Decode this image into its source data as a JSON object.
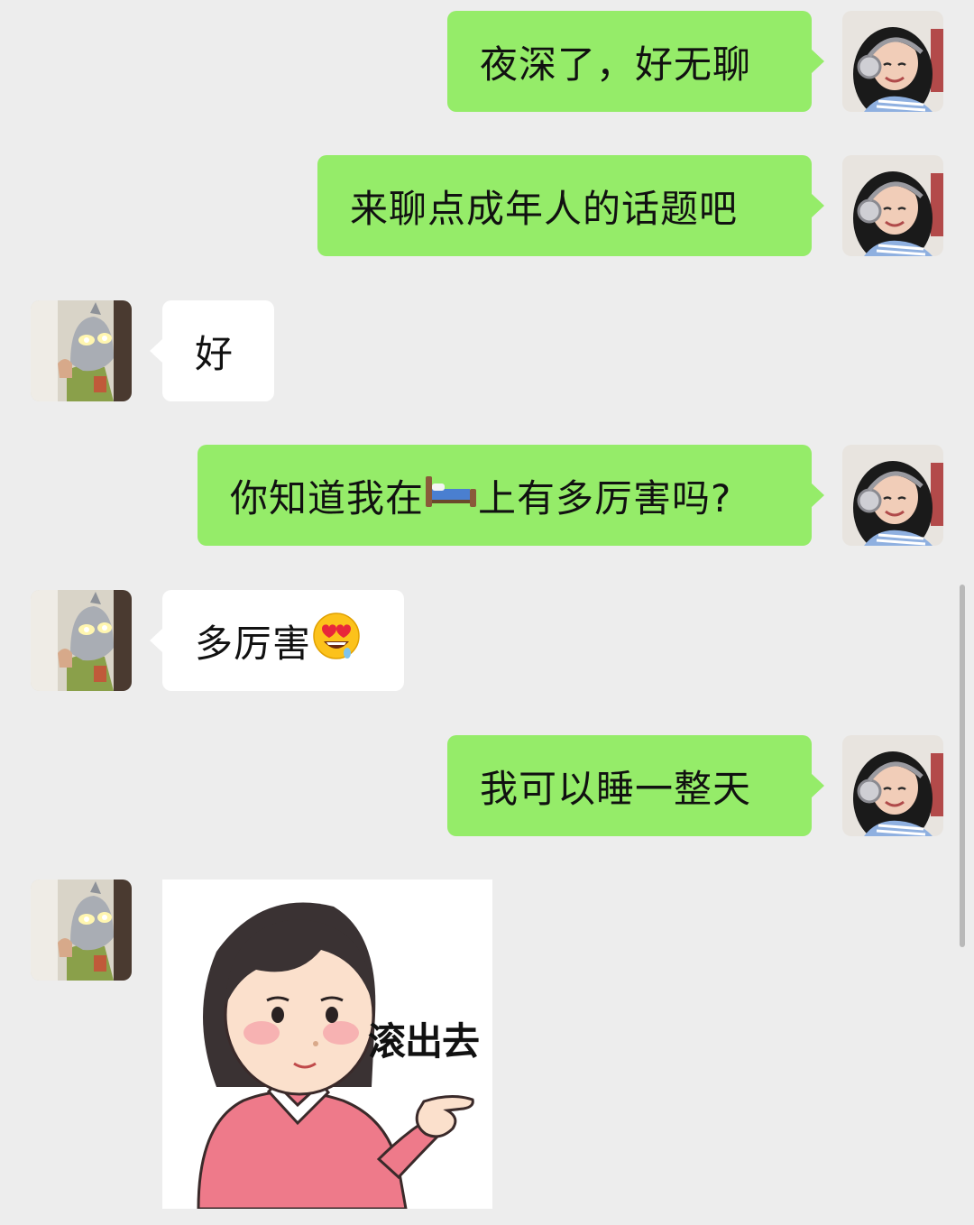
{
  "messages": [
    {
      "side": "out",
      "text": "夜深了，好无聊"
    },
    {
      "side": "out",
      "text": "来聊点成年人的话题吧"
    },
    {
      "side": "in",
      "text": "好"
    },
    {
      "side": "out",
      "text_before": "你知道我在",
      "text_after": "上有多厉害吗?",
      "inline_icon": "bed-emoji"
    },
    {
      "side": "in",
      "text": "多厉害",
      "inline_icon": "heart-eyes-drool-emoji"
    },
    {
      "side": "out",
      "text": "我可以睡一整天"
    },
    {
      "side": "in",
      "type": "sticker",
      "caption": "滚出去",
      "icon": "girl-pointing-sticker"
    }
  ],
  "colors": {
    "background": "#ededed",
    "outgoing_bubble": "#95ec69",
    "incoming_bubble": "#ffffff"
  },
  "avatars": {
    "me": "girl-with-headphones-avatar",
    "friend": "masked-hero-avatar"
  }
}
